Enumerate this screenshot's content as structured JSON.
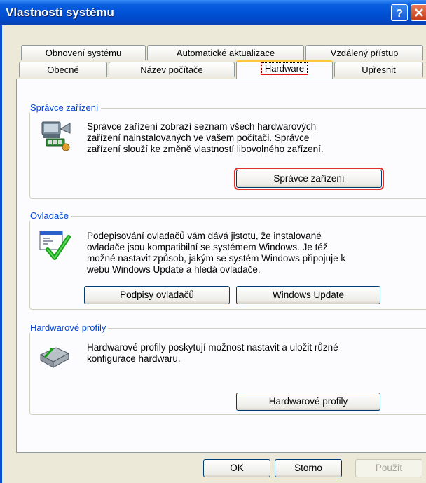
{
  "window": {
    "title": "Vlastnosti systému"
  },
  "tabs_row1": [
    {
      "label": "Obnovení systému"
    },
    {
      "label": "Automatické aktualizace"
    },
    {
      "label": "Vzdálený přístup"
    }
  ],
  "tabs_row2": [
    {
      "label": "Obecné"
    },
    {
      "label": "Název počítače"
    },
    {
      "label": "Hardware",
      "active": true
    },
    {
      "label": "Upřesnit"
    }
  ],
  "device_manager": {
    "legend": "Správce zařízení",
    "description": [
      "Správce zařízení zobrazí seznam všech hardwarových",
      "zařízení nainstalovaných ve vašem počítači. Správce",
      "zařízení slouží ke změně vlastností libovolného zařízení."
    ],
    "button_label": "Správce zařízení",
    "icon": "device-manager-icon"
  },
  "drivers": {
    "legend": "Ovladače",
    "description": [
      "Podepisování ovladačů vám dává jistotu, že instalované",
      "ovladače jsou kompatibilní se systémem Windows. Je též",
      "možné nastavit způsob, jakým se systém Windows připojuje k",
      "webu Windows Update a hledá ovladače."
    ],
    "signing_button_label": "Podpisy ovladačů",
    "update_button_label": "Windows Update",
    "icon": "driver-signing-icon"
  },
  "hardware_profiles": {
    "legend": "Hardwarové profily",
    "description": [
      "Hardwarové profily poskytují možnost nastavit a uložit různé",
      "konfigurace hardwaru."
    ],
    "button_label": "Hardwarové profily",
    "icon": "hardware-profiles-icon"
  },
  "footer": {
    "ok_label": "OK",
    "cancel_label": "Storno",
    "apply_label": "Použít"
  },
  "colors": {
    "accent": "#0046d5",
    "highlight": "#e0312b",
    "titlebar": "#0052d6"
  }
}
